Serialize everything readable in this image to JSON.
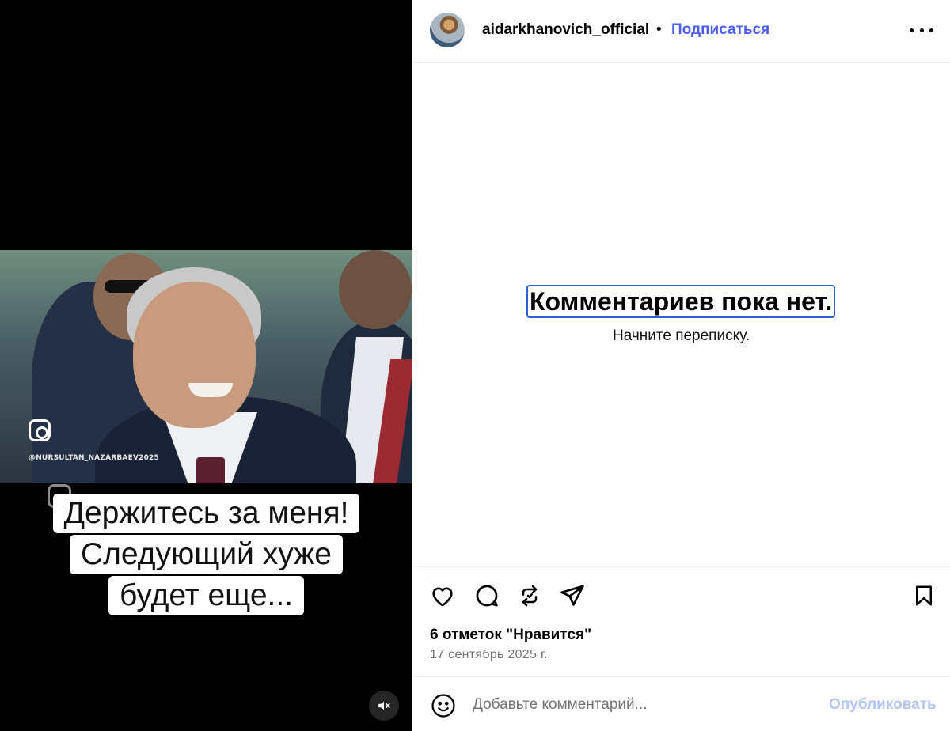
{
  "post": {
    "username": "aidarkhanovich_official",
    "separator": "•",
    "follow_label": "Подписаться",
    "more_icon": "more-horizontal-icon"
  },
  "media": {
    "watermark": "@NURSULTAN_NAZARBAEV2025",
    "caption_lines": [
      "Держитесь за меня!",
      "Следующий хуже",
      "будет еще..."
    ],
    "mute_icon": "speaker-muted-icon"
  },
  "comments": {
    "empty_title": "Комментариев пока нет.",
    "empty_subtitle": "Начните переписку."
  },
  "actions": {
    "icons": [
      "heart-icon",
      "comment-icon",
      "repost-icon",
      "share-icon",
      "bookmark-icon"
    ],
    "likes": "6 отметок \"Нравится\"",
    "date": "17 сентябрь 2025 г."
  },
  "composer": {
    "placeholder": "Добавьте комментарий...",
    "publish_label": "Опубликовать",
    "emoji_icon": "emoji-icon"
  },
  "colors": {
    "accent": "#4a5df9",
    "publish_disabled": "#b3c5f5",
    "muted_text": "#737373"
  }
}
